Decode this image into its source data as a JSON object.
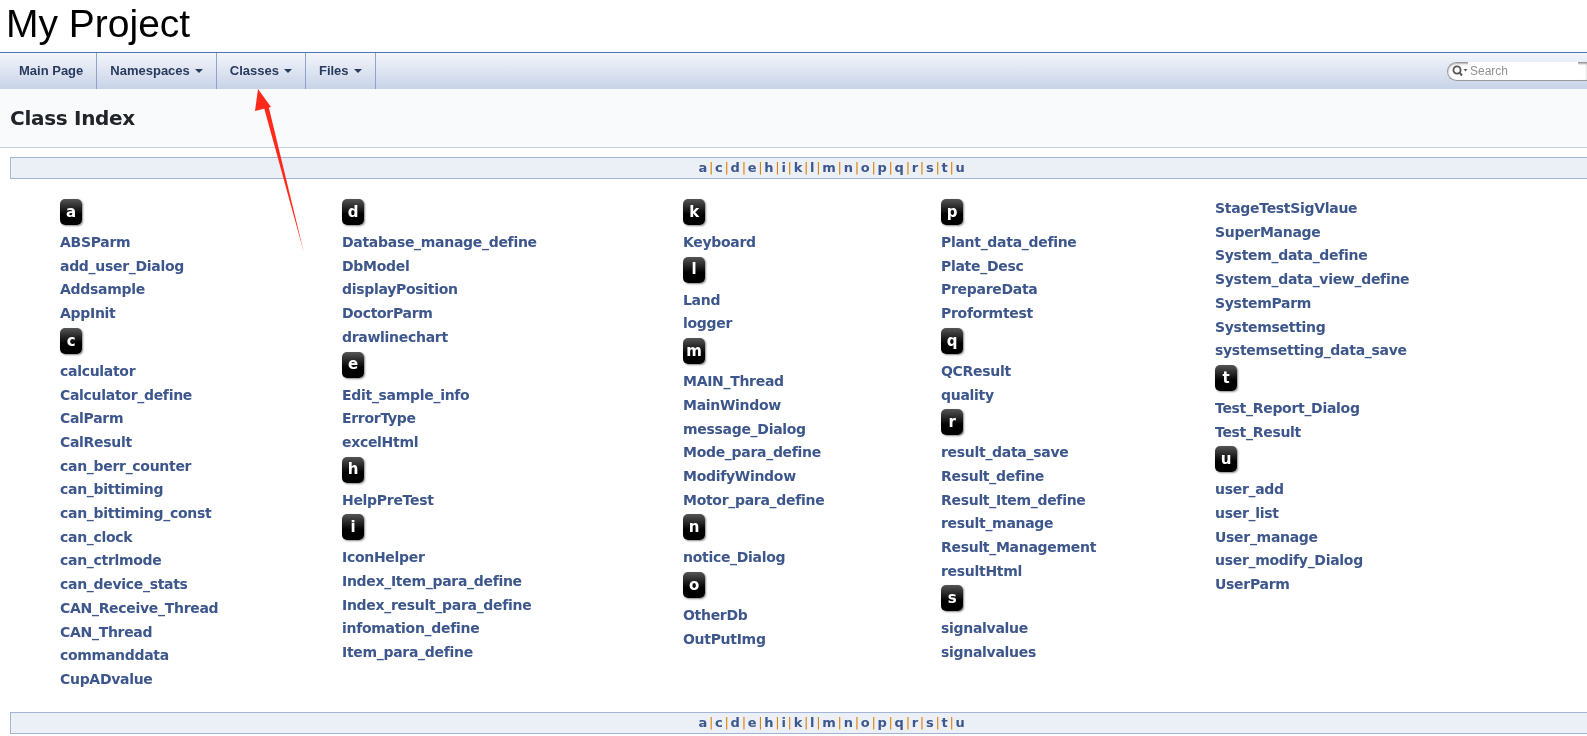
{
  "project_title": "My Project",
  "nav": {
    "tabs": [
      {
        "label": "Main Page",
        "dropdown": false
      },
      {
        "label": "Namespaces",
        "dropdown": true
      },
      {
        "label": "Classes",
        "dropdown": true
      },
      {
        "label": "Files",
        "dropdown": true
      }
    ],
    "search": {
      "placeholder": "Search"
    }
  },
  "header": {
    "title": "Class Index"
  },
  "letter_index": {
    "separator": "|",
    "letters": [
      "a",
      "c",
      "d",
      "e",
      "h",
      "i",
      "k",
      "l",
      "m",
      "n",
      "o",
      "p",
      "q",
      "r",
      "s",
      "t",
      "u"
    ]
  },
  "columns": [
    [
      {
        "kind": "letter",
        "text": "a"
      },
      {
        "kind": "class",
        "text": "ABSParm"
      },
      {
        "kind": "class",
        "text": "add_user_Dialog"
      },
      {
        "kind": "class",
        "text": "Addsample"
      },
      {
        "kind": "class",
        "text": "AppInit"
      },
      {
        "kind": "letter",
        "text": "c"
      },
      {
        "kind": "class",
        "text": "calculator"
      },
      {
        "kind": "class",
        "text": "Calculator_define"
      },
      {
        "kind": "class",
        "text": "CalParm"
      },
      {
        "kind": "class",
        "text": "CalResult"
      },
      {
        "kind": "class",
        "text": "can_berr_counter"
      },
      {
        "kind": "class",
        "text": "can_bittiming"
      },
      {
        "kind": "class",
        "text": "can_bittiming_const"
      },
      {
        "kind": "class",
        "text": "can_clock"
      },
      {
        "kind": "class",
        "text": "can_ctrlmode"
      },
      {
        "kind": "class",
        "text": "can_device_stats"
      },
      {
        "kind": "class",
        "text": "CAN_Receive_Thread"
      },
      {
        "kind": "class",
        "text": "CAN_Thread"
      },
      {
        "kind": "class",
        "text": "commanddata"
      },
      {
        "kind": "class",
        "text": "CupADvalue"
      }
    ],
    [
      {
        "kind": "letter",
        "text": "d"
      },
      {
        "kind": "class",
        "text": "Database_manage_define"
      },
      {
        "kind": "class",
        "text": "DbModel"
      },
      {
        "kind": "class",
        "text": "displayPosition"
      },
      {
        "kind": "class",
        "text": "DoctorParm"
      },
      {
        "kind": "class",
        "text": "drawlinechart"
      },
      {
        "kind": "letter",
        "text": "e"
      },
      {
        "kind": "class",
        "text": "Edit_sample_info"
      },
      {
        "kind": "class",
        "text": "ErrorType"
      },
      {
        "kind": "class",
        "text": "excelHtml"
      },
      {
        "kind": "letter",
        "text": "h"
      },
      {
        "kind": "class",
        "text": "HelpPreTest"
      },
      {
        "kind": "letter",
        "text": "i"
      },
      {
        "kind": "class",
        "text": "IconHelper"
      },
      {
        "kind": "class",
        "text": "Index_Item_para_define"
      },
      {
        "kind": "class",
        "text": "Index_result_para_define"
      },
      {
        "kind": "class",
        "text": "infomation_define"
      },
      {
        "kind": "class",
        "text": "Item_para_define"
      }
    ],
    [
      {
        "kind": "letter",
        "text": "k"
      },
      {
        "kind": "class",
        "text": "Keyboard"
      },
      {
        "kind": "letter",
        "text": "l"
      },
      {
        "kind": "class",
        "text": "Land"
      },
      {
        "kind": "class",
        "text": "logger"
      },
      {
        "kind": "letter",
        "text": "m"
      },
      {
        "kind": "class",
        "text": "MAIN_Thread"
      },
      {
        "kind": "class",
        "text": "MainWindow"
      },
      {
        "kind": "class",
        "text": "message_Dialog"
      },
      {
        "kind": "class",
        "text": "Mode_para_define"
      },
      {
        "kind": "class",
        "text": "ModifyWindow"
      },
      {
        "kind": "class",
        "text": "Motor_para_define"
      },
      {
        "kind": "letter",
        "text": "n"
      },
      {
        "kind": "class",
        "text": "notice_Dialog"
      },
      {
        "kind": "letter",
        "text": "o"
      },
      {
        "kind": "class",
        "text": "OtherDb"
      },
      {
        "kind": "class",
        "text": "OutPutImg"
      }
    ],
    [
      {
        "kind": "letter",
        "text": "p"
      },
      {
        "kind": "class",
        "text": "Plant_data_define"
      },
      {
        "kind": "class",
        "text": "Plate_Desc"
      },
      {
        "kind": "class",
        "text": "PrepareData"
      },
      {
        "kind": "class",
        "text": "Proformtest"
      },
      {
        "kind": "letter",
        "text": "q"
      },
      {
        "kind": "class",
        "text": "QCResult"
      },
      {
        "kind": "class",
        "text": "quality"
      },
      {
        "kind": "letter",
        "text": "r"
      },
      {
        "kind": "class",
        "text": "result_data_save"
      },
      {
        "kind": "class",
        "text": "Result_define"
      },
      {
        "kind": "class",
        "text": "Result_Item_define"
      },
      {
        "kind": "class",
        "text": "result_manage"
      },
      {
        "kind": "class",
        "text": "Result_Management"
      },
      {
        "kind": "class",
        "text": "resultHtml"
      },
      {
        "kind": "letter",
        "text": "s"
      },
      {
        "kind": "class",
        "text": "signalvalue"
      },
      {
        "kind": "class",
        "text": "signalvalues"
      }
    ],
    [
      {
        "kind": "class",
        "text": "StageTestSigVlaue"
      },
      {
        "kind": "class",
        "text": "SuperManage"
      },
      {
        "kind": "class",
        "text": "System_data_define"
      },
      {
        "kind": "class",
        "text": "System_data_view_define"
      },
      {
        "kind": "class",
        "text": "SystemParm"
      },
      {
        "kind": "class",
        "text": "Systemsetting"
      },
      {
        "kind": "class",
        "text": "systemsetting_data_save"
      },
      {
        "kind": "letter",
        "text": "t"
      },
      {
        "kind": "class",
        "text": "Test_Report_Dialog"
      },
      {
        "kind": "class",
        "text": "Test_Result"
      },
      {
        "kind": "letter",
        "text": "u"
      },
      {
        "kind": "class",
        "text": "user_add"
      },
      {
        "kind": "class",
        "text": "user_list"
      },
      {
        "kind": "class",
        "text": "User_manage"
      },
      {
        "kind": "class",
        "text": "user_modify_Dialog"
      },
      {
        "kind": "class",
        "text": "UserParm"
      }
    ]
  ],
  "footer_index": {
    "separator": "|",
    "letters": [
      "a",
      "c",
      "d",
      "e",
      "h",
      "i",
      "k",
      "l",
      "m",
      "n",
      "o",
      "p",
      "q",
      "r",
      "s",
      "t",
      "u"
    ]
  },
  "annotations": [
    {
      "kind": "arrow",
      "color": "#ff2a1a"
    }
  ]
}
